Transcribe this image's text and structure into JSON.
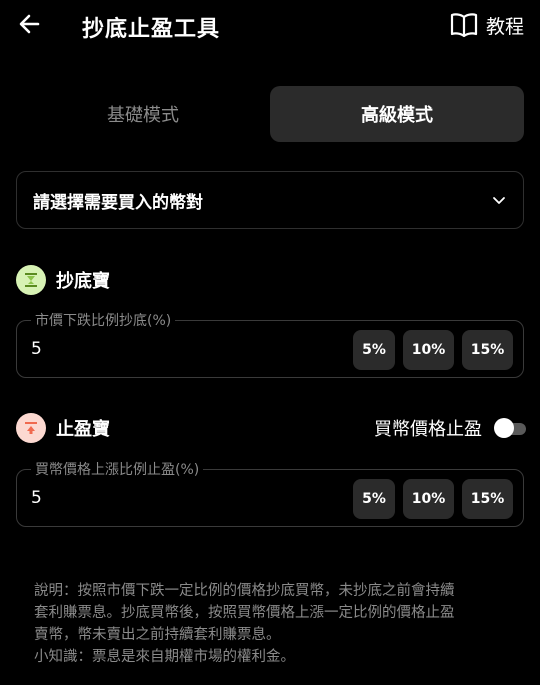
{
  "header": {
    "title": "抄底止盈工具",
    "tutorial_label": "教程",
    "icons": {
      "back": "arrow-left-icon",
      "tutorial": "book-open-icon"
    }
  },
  "tabs": [
    {
      "label": "基礎模式",
      "active": false
    },
    {
      "label": "高級模式",
      "active": true
    }
  ],
  "pair_select": {
    "placeholder": "請選擇需要買入的幣對",
    "icon": "chevron-down-icon"
  },
  "buy_low": {
    "title": "抄底寶",
    "icon": "hourglass-icon",
    "icon_color": "#8bc34a",
    "field_label": "市價下跌比例抄底(%)",
    "value": "5",
    "chips": [
      "5%",
      "10%",
      "15%"
    ]
  },
  "take_profit": {
    "title": "止盈寶",
    "icon": "arrow-up-bar-icon",
    "icon_color": "#f06a4f",
    "toggle_label": "買幣價格止盈",
    "toggle_on": false,
    "field_label": "買幣價格上漲比例止盈(%)",
    "value": "5",
    "chips": [
      "5%",
      "10%",
      "15%"
    ]
  },
  "description": {
    "line1": "說明：按照市價下跌一定比例的價格抄底買幣，未抄底之前會持續",
    "line2": "套利賺票息。抄底買幣後，按照買幣價格上漲一定比例的價格止盈",
    "line3": "賣幣，幣未賣出之前持續套利賺票息。",
    "line4": "小知識：票息是來自期權市場的權利金。"
  }
}
